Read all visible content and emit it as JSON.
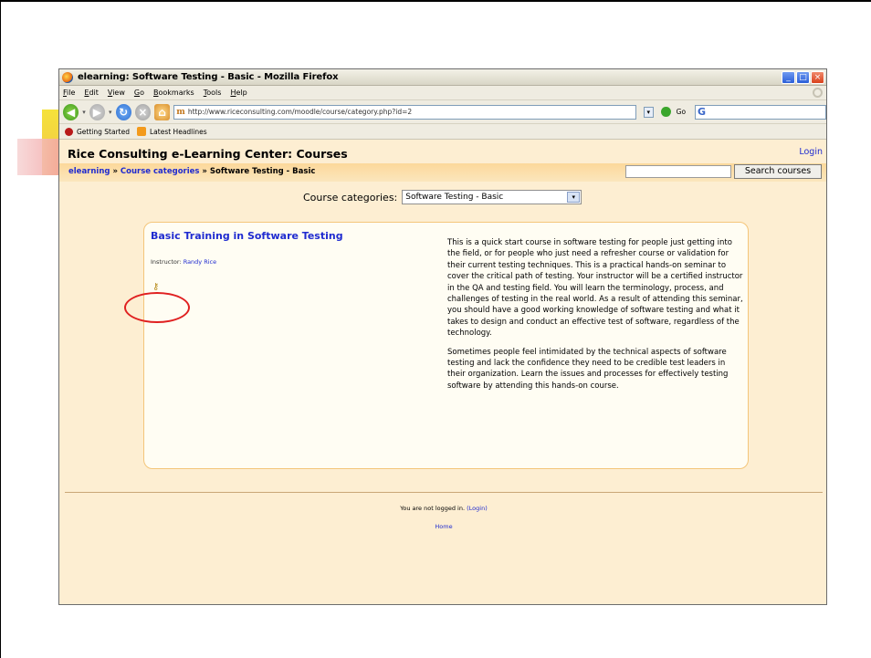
{
  "browser": {
    "window_title": "elearning: Software Testing - Basic - Mozilla Firefox",
    "menu": [
      "File",
      "Edit",
      "View",
      "Go",
      "Bookmarks",
      "Tools",
      "Help"
    ],
    "url": "http://www.riceconsulting.com/moodle/course/category.php?id=2",
    "go_label": "Go",
    "search_text": "G",
    "bookmarks": [
      "Getting Started",
      "Latest Headlines"
    ]
  },
  "page": {
    "site_title": "Rice Consulting e-Learning Center: Courses",
    "login_link": "Login",
    "breadcrumb": {
      "home": "elearning",
      "sep": " » ",
      "categories": "Course categories",
      "current": "Software Testing - Basic"
    },
    "search_button": "Search courses",
    "category_label": "Course categories:",
    "category_selected": "Software Testing - Basic",
    "course": {
      "title": "Basic Training in Software Testing",
      "instructor_label": "Instructor:",
      "instructor_name": "Randy Rice",
      "summary_p1": "This is a quick start course in software testing for people just getting into the field, or for people who just need a refresher course or validation for their current testing techniques. This is a practical hands-on seminar to cover the critical path of testing. Your instructor will be a certified instructor in the QA and testing field. You will learn the terminology, process, and challenges of testing in the real world. As a result of attending this seminar, you should have a good working knowledge of software testing and what it takes to design and conduct an effective test of software, regardless of the technology.",
      "summary_p2": "Sometimes people feel intimidated by the technical aspects of software testing and lack the confidence they need to be credible test leaders in their organization. Learn the issues and processes for effectively testing software by attending this hands-on course."
    },
    "footer": {
      "not_logged": "You are not logged in.",
      "login_paren": "(Login)",
      "home": "Home"
    }
  },
  "icons": {
    "enrol_key": "key-icon",
    "highlight_color": "#e02020"
  }
}
